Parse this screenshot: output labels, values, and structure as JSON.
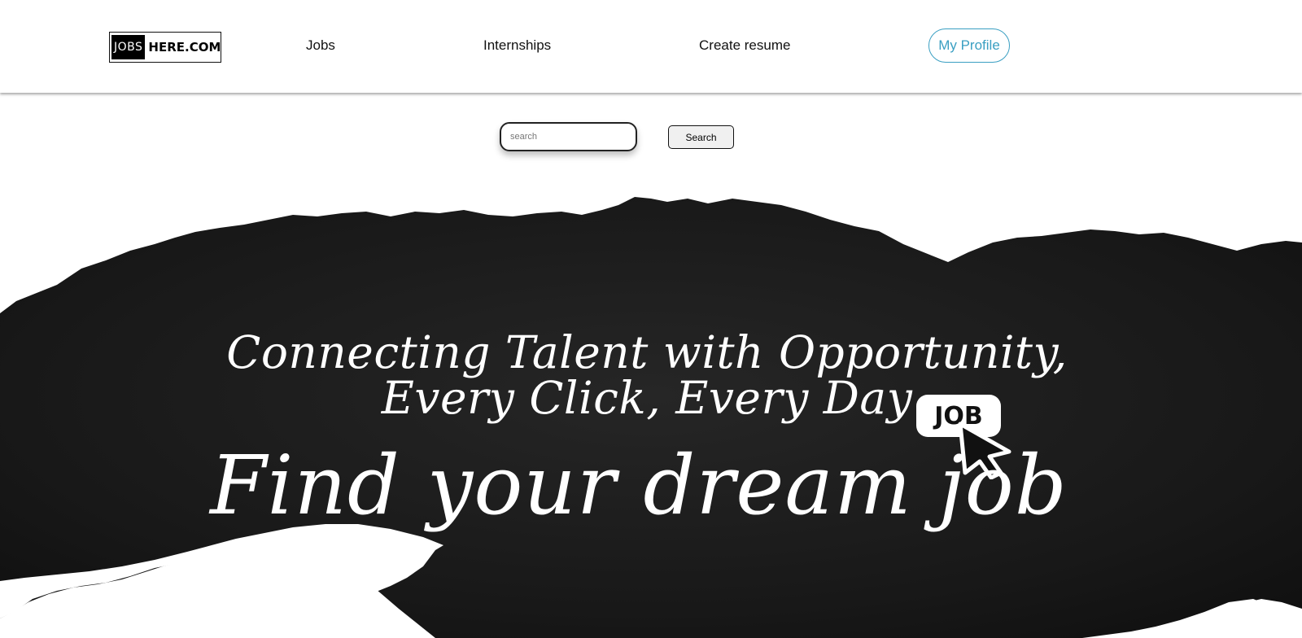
{
  "header": {
    "logo": {
      "part1": "JOBS",
      "part2": "HERE.COM"
    },
    "nav": [
      {
        "label": "Jobs"
      },
      {
        "label": "Internships"
      },
      {
        "label": "Create resume"
      }
    ],
    "profile_label": "My Profile"
  },
  "search": {
    "placeholder": "search",
    "button_label": "Search"
  },
  "hero": {
    "tagline": "Connecting Talent with Opportunity, Every Click, Every Day",
    "headline": "Find your dream job",
    "badge_text": "JOB"
  },
  "colors": {
    "accent": "#3a9fc2",
    "hero_background": "#1b1b1b",
    "text_light": "#ffffff"
  },
  "icons": {
    "badge_pointer": "cursor-pointer-icon"
  }
}
